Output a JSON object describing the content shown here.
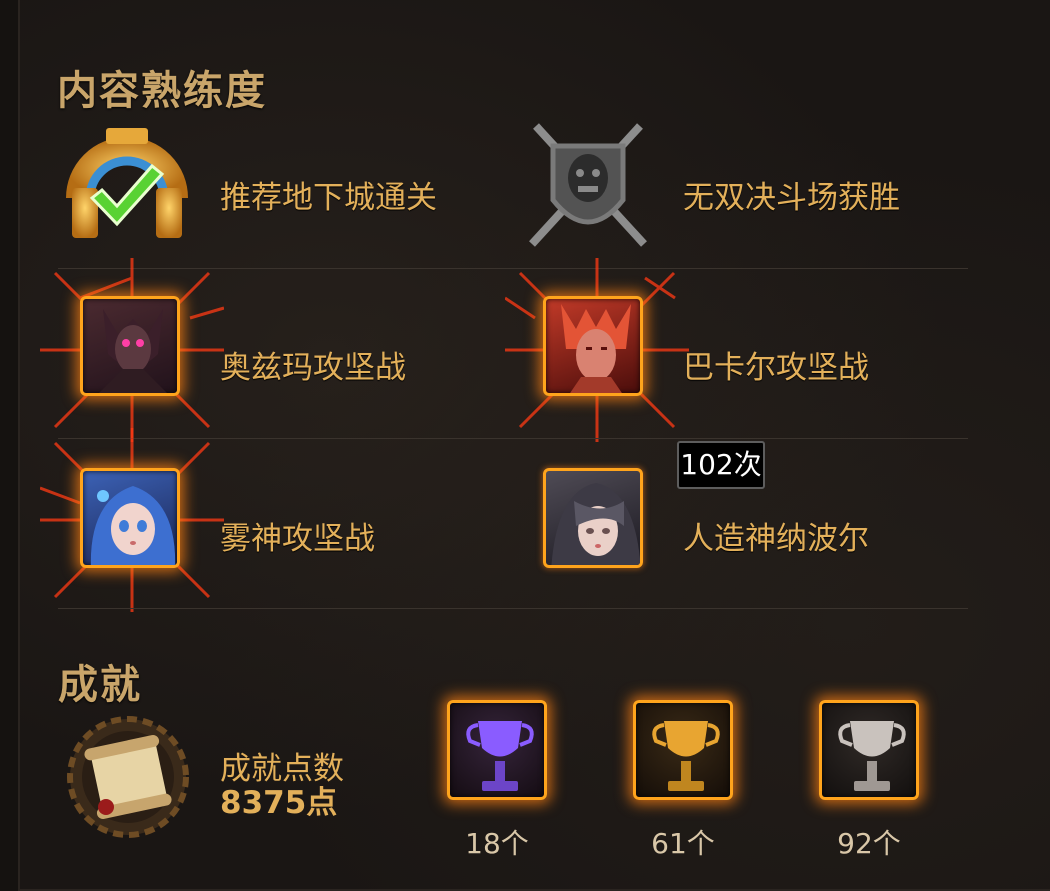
{
  "proficiency": {
    "title": "内容熟练度",
    "items": [
      {
        "label": "推荐地下城通关",
        "icon": "dungeon-clear-icon"
      },
      {
        "label": "无双决斗场获胜",
        "icon": "arena-shield-icon"
      },
      {
        "label": "奥兹玛攻坚战",
        "icon": "ozma-portrait-icon"
      },
      {
        "label": "巴卡尔攻坚战",
        "icon": "bakal-portrait-icon"
      },
      {
        "label": "雾神攻坚战",
        "icon": "mist-goddess-portrait-icon"
      },
      {
        "label": "人造神纳波尔",
        "icon": "napol-portrait-icon"
      }
    ]
  },
  "tooltip": {
    "text": "102次"
  },
  "achievement": {
    "title": "成就",
    "points_label": "成就点数",
    "points_value": "8375点",
    "trophies": [
      {
        "count": "18个",
        "tier": "purple",
        "color": "#8a5cff"
      },
      {
        "count": "61个",
        "tier": "gold",
        "color": "#e8a531"
      },
      {
        "count": "92个",
        "tier": "silver",
        "color": "#c9c2bd"
      }
    ]
  },
  "colors": {
    "accent": "#ffa41c",
    "label": "#e3b05a",
    "title": "#c9a56a"
  }
}
